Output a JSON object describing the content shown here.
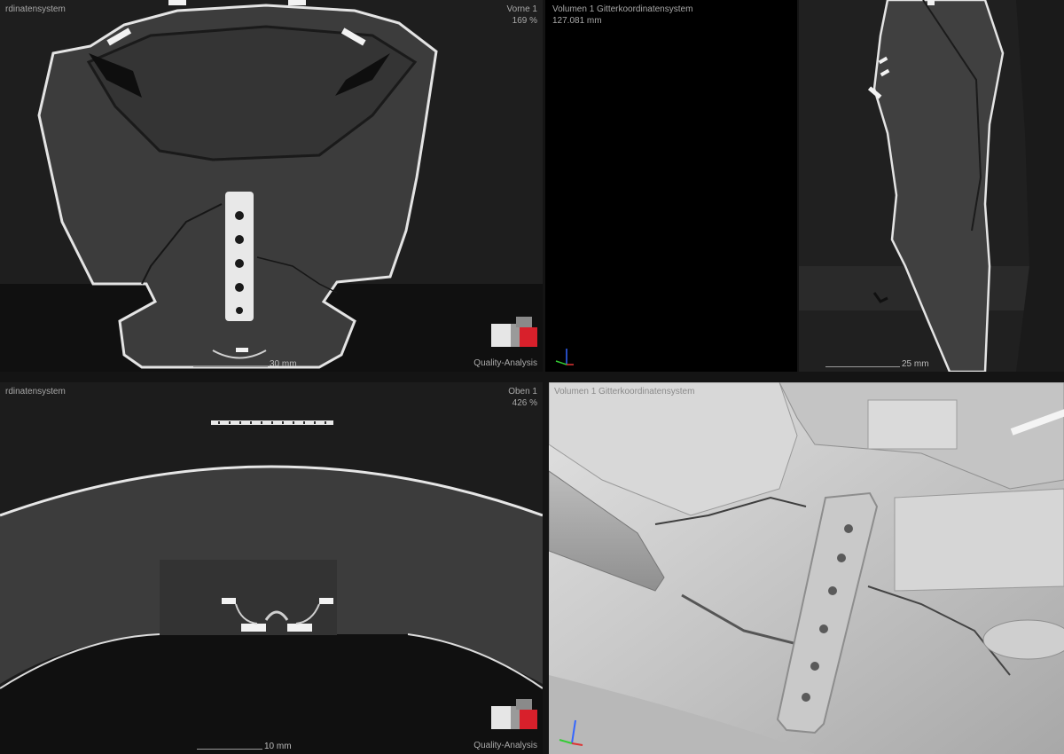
{
  "colors": {
    "background": "#141414",
    "scan_bone": "#3b3b3b",
    "scan_edge": "#e6e6e6",
    "render_surface": "#d4d4d4",
    "logo_red": "#d8202b"
  },
  "viewports": {
    "front": {
      "title": "rdinatensystem",
      "name": "Vorne 1",
      "zoom": "169 %",
      "scale": "30 mm",
      "brand": "Quality-Analysis"
    },
    "volume": {
      "title": "Volumen 1 Gitterkoordinatensystem",
      "measurement": "127.081 mm"
    },
    "side": {
      "scale": "25 mm"
    },
    "top": {
      "title": "rdinatensystem",
      "name": "Oben 1",
      "zoom": "426 %",
      "scale": "10 mm",
      "brand": "Quality-Analysis"
    },
    "render": {
      "title": "Volumen 1 Gitterkoordinatensystem"
    }
  },
  "icons": {
    "cube": "view-cube-icon",
    "axis": "axis-triad-icon"
  }
}
